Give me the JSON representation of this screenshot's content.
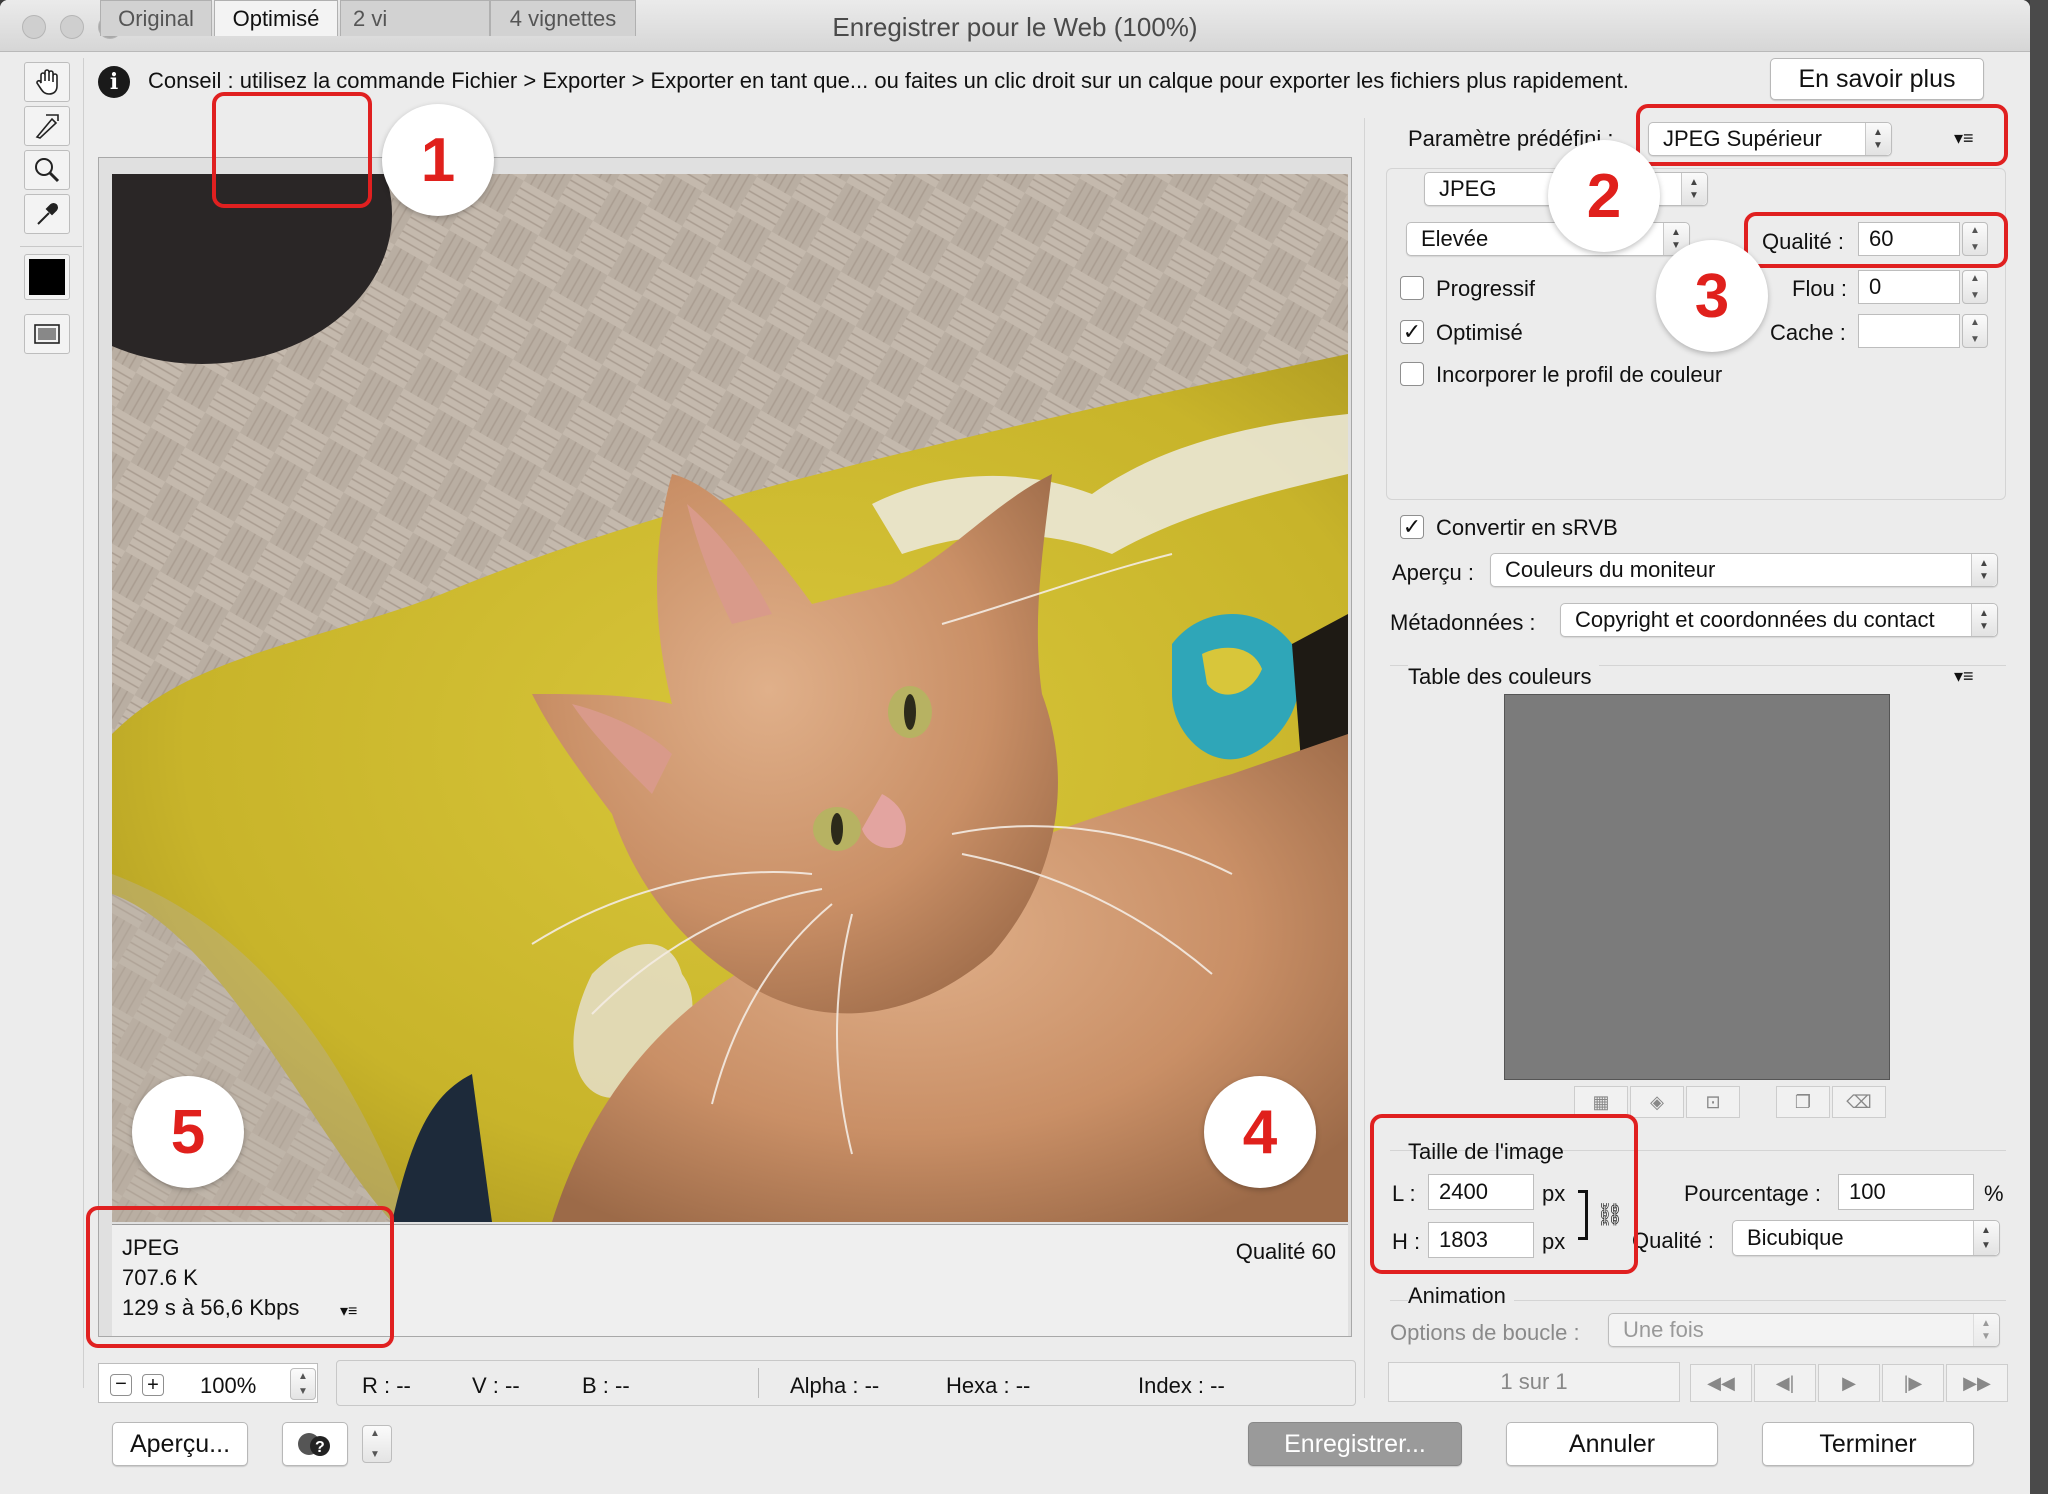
{
  "window": {
    "title": "Enregistrer pour le Web (100%)"
  },
  "tip": {
    "text": "Conseil : utilisez la commande Fichier > Exporter > Exporter en tant que... ou faites un clic droit sur un calque pour exporter les fichiers plus rapidement.",
    "learn_more": "En savoir plus"
  },
  "tabs": [
    {
      "label": "Original",
      "active": false
    },
    {
      "label": "Optimisé",
      "active": true
    },
    {
      "label": "2 vi",
      "active": false
    },
    {
      "label": "4 vignettes",
      "active": false
    }
  ],
  "preview": {
    "format": "JPEG",
    "size": "707.6 K",
    "time": "129 s à 56,6 Kbps",
    "quality_label": "Qualité 60"
  },
  "zoom": {
    "value": "100%"
  },
  "pixel_info": {
    "r": "R : --",
    "v": "V : --",
    "b": "B : --",
    "alpha": "Alpha : --",
    "hexa": "Hexa : --",
    "index": "Index : --"
  },
  "settings": {
    "preset_label": "Paramètre prédéfini :",
    "preset_value": "JPEG Supérieur",
    "format_value": "JPEG",
    "compression_value": "Elevée",
    "quality_label": "Qualité :",
    "quality_value": "60",
    "blur_label": "Flou :",
    "blur_value": "0",
    "matte_label": "Cache :",
    "matte_value": "",
    "progressive": {
      "label": "Progressif",
      "checked": false
    },
    "optimized": {
      "label": "Optimisé",
      "checked": true
    },
    "embed_profile": {
      "label": "Incorporer le profil de couleur",
      "checked": false
    },
    "convert_srgb": {
      "label": "Convertir en sRVB",
      "checked": true
    },
    "preview_label": "Aperçu :",
    "preview_value": "Couleurs du moniteur",
    "metadata_label": "Métadonnées :",
    "metadata_value": "Copyright et coordonnées du contact"
  },
  "color_table": {
    "title": "Table des couleurs"
  },
  "image_size": {
    "title": "Taille de l'image",
    "width_label": "L :",
    "width_value": "2400",
    "height_label": "H :",
    "height_value": "1803",
    "unit": "px",
    "percent_label": "Pourcentage :",
    "percent_value": "100",
    "percent_unit": "%",
    "quality_label": "Qualité :",
    "quality_value": "Bicubique"
  },
  "animation": {
    "title": "Animation",
    "loop_label": "Options de boucle :",
    "loop_value": "Une fois",
    "frame_counter": "1 sur 1"
  },
  "footer": {
    "preview_button": "Aperçu...",
    "save_button": "Enregistrer...",
    "cancel_button": "Annuler",
    "done_button": "Terminer"
  },
  "annotations": [
    "1",
    "2",
    "3",
    "4",
    "5"
  ],
  "colors": {
    "annotation_red": "#e02020",
    "window_bg": "#ececec"
  }
}
